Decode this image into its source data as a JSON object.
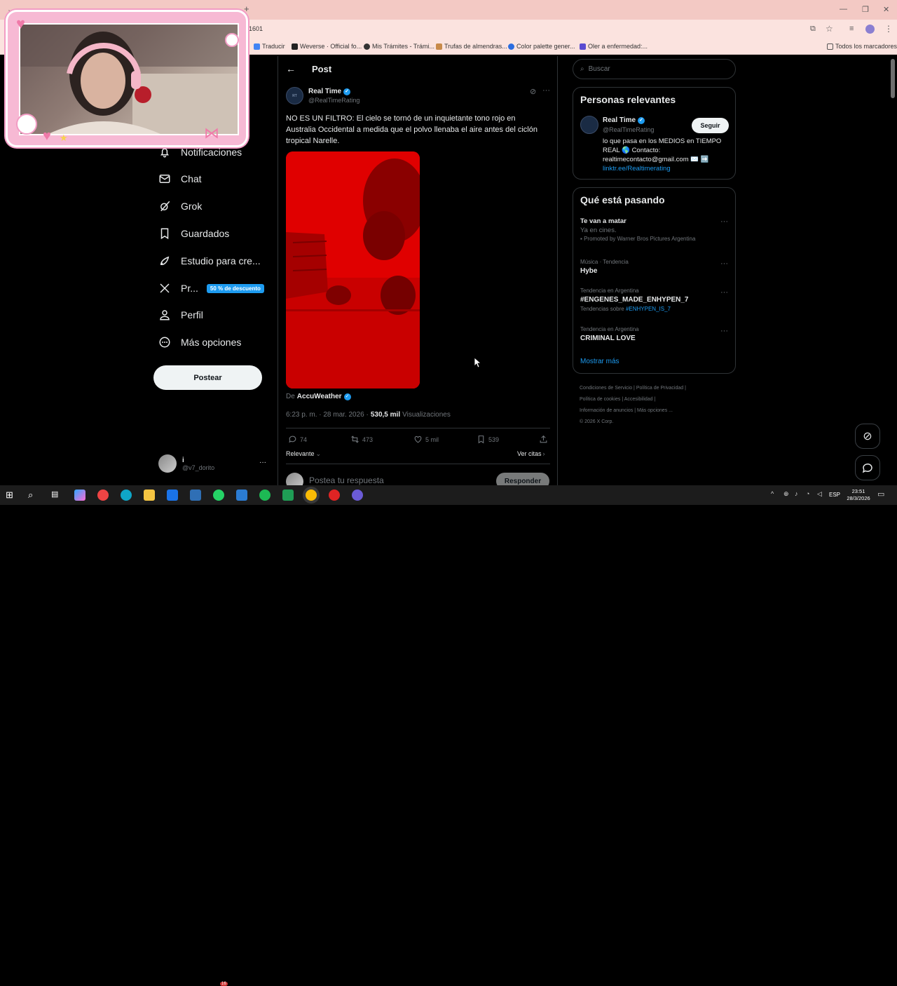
{
  "browser": {
    "url_fragment": "1601",
    "bookmarks": [
      {
        "label": "Traducir",
        "color": "#4285f4"
      },
      {
        "label": "Weverse · Official fo...",
        "color": "#222222"
      },
      {
        "label": "Mis Trámites - Trámi...",
        "color": "#333333"
      },
      {
        "label": "Trufas de almendras...",
        "color": "#c88a4a"
      },
      {
        "label": "Color palette gener...",
        "color": "#2b6de0"
      },
      {
        "label": "Oler a enfermedad:...",
        "color": "#5a4bd1"
      }
    ],
    "all_bookmarks": "Todos los marcadores"
  },
  "sidebar": {
    "items": [
      {
        "label": "Notificaciones",
        "icon": "bell-icon"
      },
      {
        "label": "Chat",
        "icon": "mail-icon"
      },
      {
        "label": "Grok",
        "icon": "grok-icon"
      },
      {
        "label": "Guardados",
        "icon": "bookmark-icon"
      },
      {
        "label": "Estudio para cre...",
        "icon": "rocket-icon"
      },
      {
        "label": "Pr...",
        "icon": "x-logo-icon",
        "badge": "50 % de descuento"
      },
      {
        "label": "Perfil",
        "icon": "person-icon"
      },
      {
        "label": "Más opciones",
        "icon": "more-circle-icon"
      }
    ],
    "post_button": "Postear",
    "account": {
      "name": "i",
      "handle": "@v7_dorito",
      "more": "···"
    }
  },
  "post": {
    "header_title": "Post",
    "author_name": "Real Time",
    "author_handle": "@RealTimeRating",
    "text": "NO ES UN FILTRO: El cielo se tornó de un inquietante tono rojo en Australia Occidental a medida que el polvo llenaba el aire antes del ciclón tropical Narelle.",
    "source_prefix": "De",
    "source_name": "AccuWeather",
    "timestamp": "6:23 p. m. · 28 mar. 2026 ·",
    "views_count": "530,5 mil",
    "views_label": "Visualizaciones",
    "actions": {
      "replies": "74",
      "reposts": "473",
      "likes": "5 mil",
      "bookmarks": "539"
    },
    "sort_label": "Relevante",
    "quotes_label": "Ver citas",
    "reply_placeholder": "Postea tu respuesta",
    "reply_button": "Responder"
  },
  "search": {
    "placeholder": "Buscar"
  },
  "relevant": {
    "title": "Personas relevantes",
    "name": "Real Time",
    "handle": "@RealTimeRating",
    "follow": "Seguir",
    "bio": "lo que pasa en los MEDIOS en TIEMPO REAL 🌎 Contacto: realtimecontacto@gmail.com ✉️ ➡️",
    "link": "linktr.ee/Realtimerating"
  },
  "trends": {
    "title": "Qué está pasando",
    "items": [
      {
        "meta": "",
        "name": "Te van a matar",
        "sub": "Ya en cines.",
        "extra": "Promoted by Warner Bros Pictures Argentina"
      },
      {
        "meta": "Música · Tendencia",
        "name": "Hybe",
        "sub": "",
        "extra": ""
      },
      {
        "meta": "Tendencia en Argentina",
        "name": "#ENGENES_MADE_ENHYPEN_7",
        "sub": "Tendencias sobre",
        "extra": "#ENHYPEN_IS_7"
      },
      {
        "meta": "Tendencia en Argentina",
        "name": "CRIMINAL LOVE",
        "sub": "",
        "extra": ""
      }
    ],
    "show_more": "Mostrar más"
  },
  "footer": {
    "links": [
      "Condiciones de Servicio",
      "Política de Privacidad",
      "Política de cookies",
      "Accesibilidad",
      "Información de anuncios",
      "Más opciones ..."
    ],
    "copyright": "© 2026 X Corp."
  },
  "taskbar": {
    "lang": "ESP",
    "time": "23:51",
    "date": "28/3/2026",
    "whatsapp_badge": "16"
  },
  "colors": {
    "accent": "#1d9bf0",
    "red_media": "#e10000",
    "webcam_frame": "#f7b9d4"
  }
}
